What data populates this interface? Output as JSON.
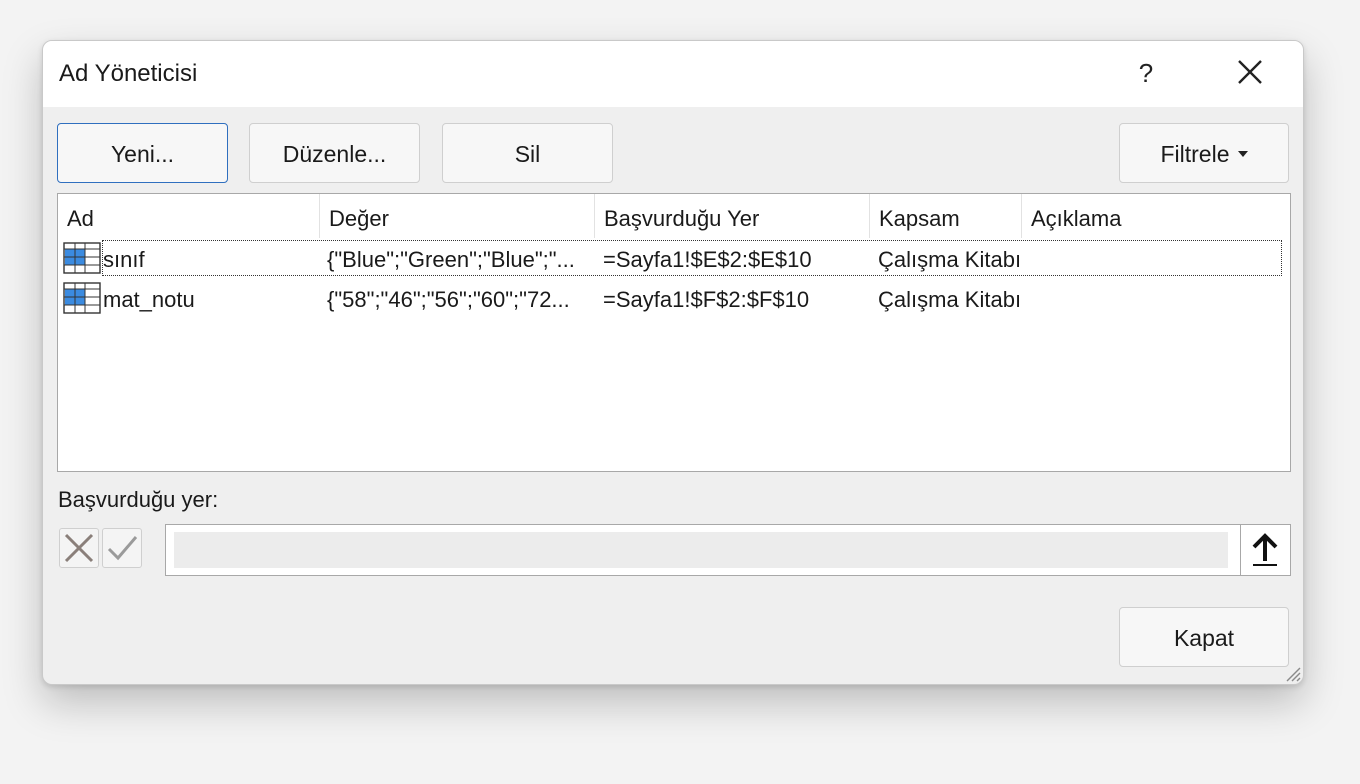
{
  "dialog": {
    "title": "Ad Yöneticisi",
    "help_label": "?"
  },
  "toolbar": {
    "new_label": "Yeni...",
    "edit_label": "Düzenle...",
    "delete_label": "Sil",
    "filter_label": "Filtrele"
  },
  "list": {
    "columns": [
      "Ad",
      "Değer",
      "Başvurduğu Yer",
      "Kapsam",
      "Açıklama"
    ],
    "rows": [
      {
        "name": "sınıf",
        "value": "{\"Blue\";\"Green\";\"Blue\";\"...",
        "refers_to": "=Sayfa1!$E$2:$E$10",
        "scope": "Çalışma Kitabı",
        "comment": ""
      },
      {
        "name": "mat_notu",
        "value": "{\"58\";\"46\";\"56\";\"60\";\"72...",
        "refers_to": "=Sayfa1!$F$2:$F$10",
        "scope": "Çalışma Kitabı",
        "comment": ""
      }
    ]
  },
  "refers_to": {
    "label": "Başvurduğu yer:",
    "value": ""
  },
  "footer": {
    "close_label": "Kapat"
  },
  "colors": {
    "primary_border": "#2f6fbf",
    "grid_icon_blue": "#3b8be0"
  }
}
